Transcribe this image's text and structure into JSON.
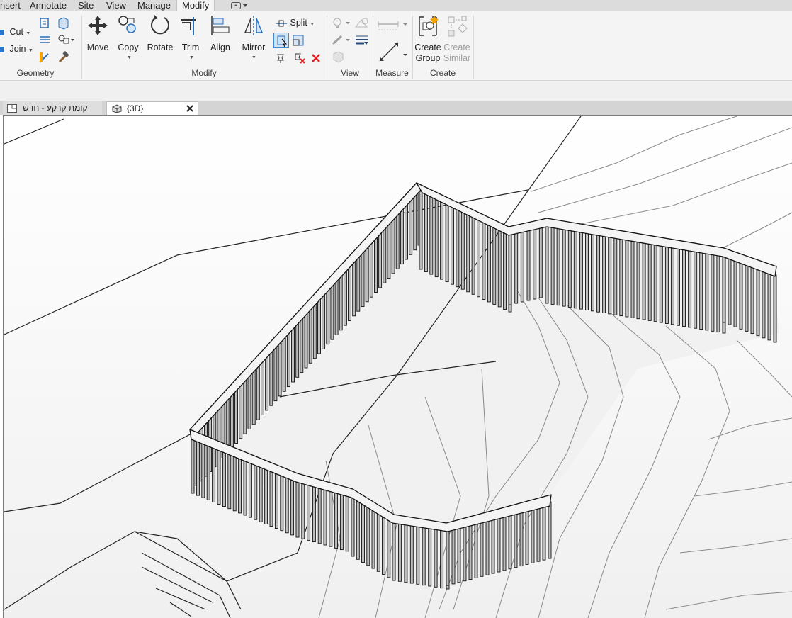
{
  "menu_tabs": [
    "nsert",
    "Annotate",
    "Site",
    "View",
    "Manage",
    "Modify"
  ],
  "active_tab": "Modify",
  "ribbon": {
    "geometry": {
      "cut": "Cut",
      "join": "Join",
      "title": "Geometry"
    },
    "modify": {
      "move": "Move",
      "copy": "Copy",
      "rotate": "Rotate",
      "trim": "Trim",
      "align": "Align",
      "mirror": "Mirror",
      "split": "Split",
      "title": "Modify"
    },
    "view": {
      "title": "View"
    },
    "measure": {
      "title": "Measure"
    },
    "create": {
      "create_group_1": "Create",
      "create_group_2": "Group",
      "create_similar_1": "Create",
      "create_similar_2": "Similar",
      "title": "Create"
    }
  },
  "doc_tabs": [
    {
      "label": "קומת קרקע - חדש",
      "active": false
    },
    {
      "label": "{3D}",
      "active": true
    }
  ],
  "colors": {
    "ribbon_bg": "#f4f4f4",
    "tab_bar": "#dcdcdc",
    "viewport_bg": "#fafafa",
    "close_red": "#e02020"
  }
}
